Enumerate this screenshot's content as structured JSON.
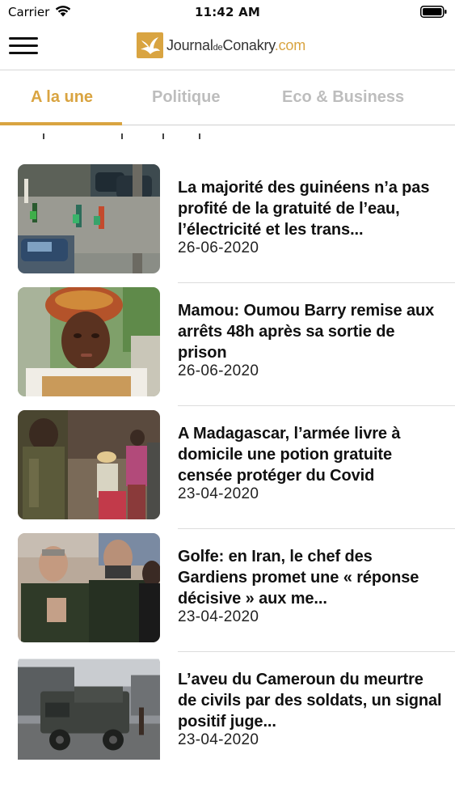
{
  "status_bar": {
    "carrier": "Carrier",
    "time": "11:42 AM",
    "icons": [
      "wifi-icon",
      "battery-icon"
    ]
  },
  "header": {
    "menu_icon": "hamburger-menu-icon",
    "logo": {
      "icon": "dove-logo-icon",
      "part_journal": "Journal",
      "part_de": "de",
      "part_conakry": "Conakry",
      "part_com": ".com"
    }
  },
  "tabs": [
    {
      "label": "A la une",
      "active": true
    },
    {
      "label": "Politique",
      "active": false
    },
    {
      "label": "Eco & Business",
      "active": false
    }
  ],
  "articles": [
    {
      "title": "La majorité des guinéens n’a pas profité de la gratuité de l’eau, l’électricité et les trans...",
      "date": "26-06-2020",
      "image": "street-water-carriers-photo"
    },
    {
      "title": "Mamou: Oumou Barry remise aux arrêts 48h après sa sortie de prison",
      "date": "26-06-2020",
      "image": "woman-portrait-photo"
    },
    {
      "title": "A Madagascar, l’armée livre à domicile une potion gratuite censée protéger du Covid",
      "date": "23-04-2020",
      "image": "soldier-delivery-photo"
    },
    {
      "title": "Golfe: en Iran, le chef des Gardiens promet une « réponse décisive » aux me...",
      "date": "23-04-2020",
      "image": "iranian-officers-photo"
    },
    {
      "title": "L’aveu du Cameroun du meurtre de civils par des soldats, un signal positif juge...",
      "date": "23-04-2020",
      "image": "military-truck-photo"
    }
  ],
  "colors": {
    "accent": "#d9a441",
    "tab_inactive": "#bdbdbd",
    "text": "#111111",
    "divider": "#dcdcdc"
  }
}
